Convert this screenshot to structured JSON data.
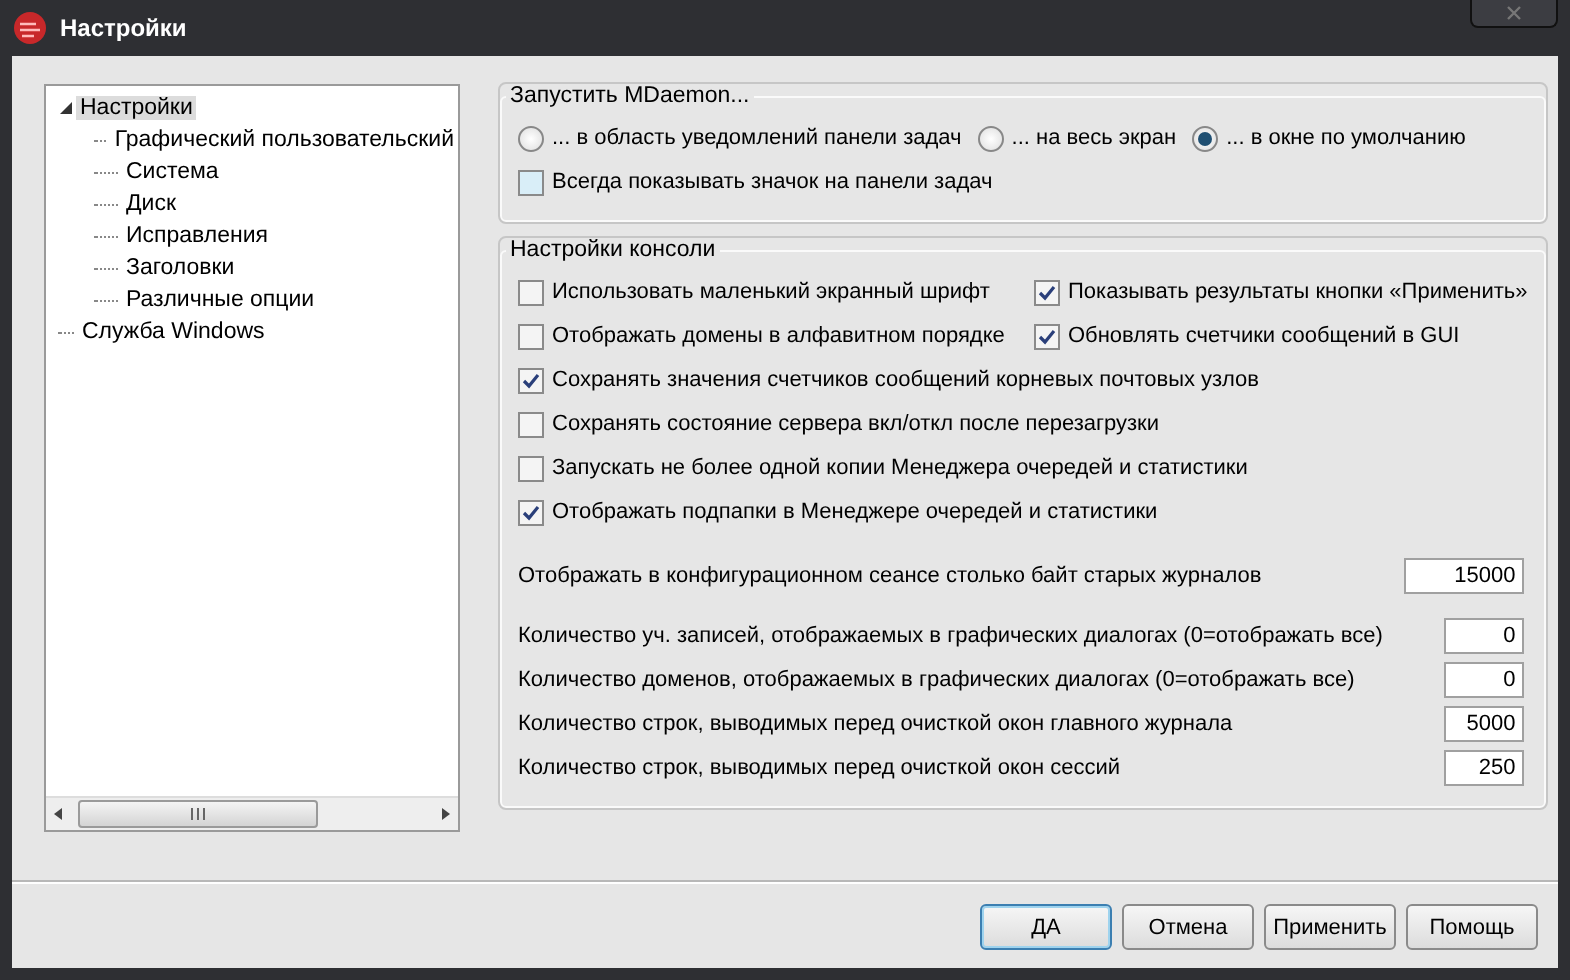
{
  "window": {
    "title": "Настройки"
  },
  "tree": [
    {
      "label": "Настройки",
      "selected": true,
      "expanded": true,
      "children": [
        {
          "label": "Графический пользовательский",
          "selected": false
        },
        {
          "label": "Система",
          "selected": false
        },
        {
          "label": "Диск",
          "selected": false
        },
        {
          "label": "Исправления",
          "selected": false
        },
        {
          "label": "Заголовки",
          "selected": false
        },
        {
          "label": "Различные опции",
          "selected": false
        }
      ]
    },
    {
      "label": "Служба Windows",
      "selected": false
    }
  ],
  "launch": {
    "title": "Запустить MDaemon...",
    "radios": [
      {
        "label": "... в область уведомлений панели задач",
        "selected": false
      },
      {
        "label": "... на весь экран",
        "selected": false
      },
      {
        "label": "... в окне по умолчанию",
        "selected": true
      }
    ],
    "tray_icon": {
      "label": "Всегда показывать значок на панели задач",
      "checked": false
    }
  },
  "console": {
    "title": "Настройки консоли",
    "rows": [
      [
        {
          "label": "Использовать маленький экранный шрифт",
          "checked": false
        },
        {
          "label": "Показывать результаты кнопки «Применить»",
          "checked": true
        }
      ],
      [
        {
          "label": "Отображать домены в алфавитном порядке",
          "checked": false
        },
        {
          "label": "Обновлять счетчики сообщений в GUI",
          "checked": true
        }
      ],
      [
        {
          "label": "Сохранять значения счетчиков сообщений корневых почтовых узлов",
          "checked": true
        }
      ],
      [
        {
          "label": "Сохранять состояние сервера вкл/откл после перезагрузки",
          "checked": false
        }
      ],
      [
        {
          "label": "Запускать не более одной копии Менеджера очередей и статистики",
          "checked": false
        }
      ],
      [
        {
          "label": "Отображать подпапки в Менеджере очередей и статистики",
          "checked": true
        }
      ]
    ],
    "fields": [
      {
        "label": "Отображать в конфигурационном сеансе столько байт старых журналов",
        "value": "15000"
      },
      {
        "label": "Количество уч. записей, отображаемых в графических диалогах (0=отображать все)",
        "value": "0"
      },
      {
        "label": "Количество доменов, отображаемых в графических диалогах (0=отображать все)",
        "value": "0"
      },
      {
        "label": "Количество строк, выводимых перед очисткой окон главного журнала",
        "value": "5000"
      },
      {
        "label": "Количество строк, выводимых перед очисткой окон сессий",
        "value": "250"
      }
    ]
  },
  "buttons": [
    {
      "label": "ДА",
      "default": true
    },
    {
      "label": "Отмена",
      "default": false
    },
    {
      "label": "Применить",
      "default": false
    },
    {
      "label": "Помощь",
      "default": false
    }
  ]
}
